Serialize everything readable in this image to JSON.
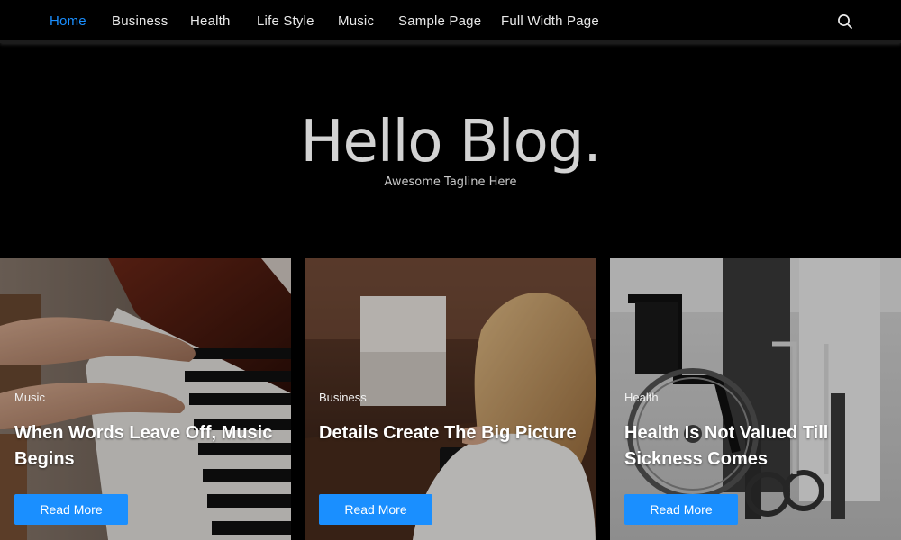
{
  "nav": {
    "items": [
      {
        "label": "Home",
        "active": true
      },
      {
        "label": "Business"
      },
      {
        "label": "Health"
      },
      {
        "label": "Life Style"
      },
      {
        "label": "Music"
      },
      {
        "label": "Sample Page"
      },
      {
        "label": "Full Width Page"
      }
    ],
    "search_icon": "search-icon"
  },
  "hero": {
    "title": "Hello Blog.",
    "tagline": "Awesome Tagline Here"
  },
  "cards": [
    {
      "category": "Music",
      "title": "When Words Leave Off, Music Begins",
      "button": "Read More"
    },
    {
      "category": "Business",
      "title": "Details Create The Big Picture",
      "button": "Read More"
    },
    {
      "category": "Health",
      "title": "Health Is Not Valued Till Sickness Comes",
      "button": "Read More"
    }
  ],
  "colors": {
    "accent": "#1a8fff",
    "background": "#000000",
    "title": "#d3d3d3"
  }
}
